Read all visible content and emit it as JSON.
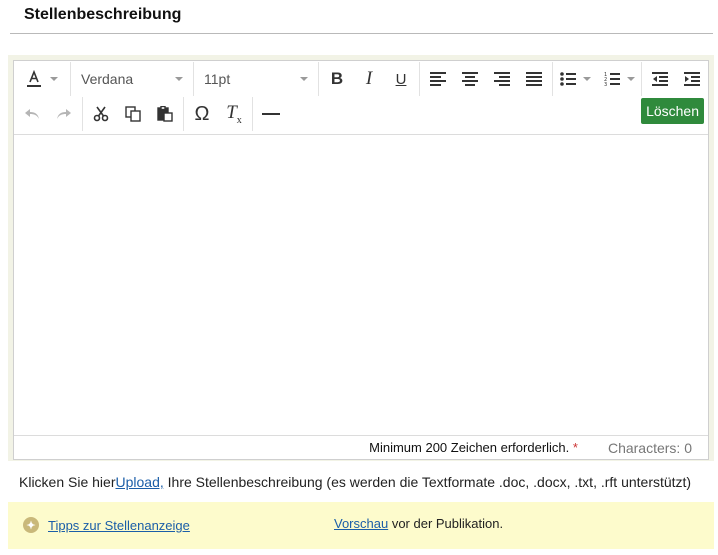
{
  "header": {
    "title": "Stellenbeschreibung"
  },
  "toolbar": {
    "font_family": "Verdana",
    "font_size": "11pt",
    "delete_label": "Löschen"
  },
  "editor": {
    "status_required": "Minimum 200 Zeichen erforderlich.",
    "required_mark": "*",
    "characters": "Characters: 0"
  },
  "upload": {
    "prefix": "Klicken Sie hier",
    "link": "Upload,",
    "suffix": " Ihre Stellenbeschreibung (es werden die Textformate .doc, .docx, .txt, .rft unterstützt)"
  },
  "tips": {
    "link": "Tipps zur Stellenanzeige",
    "preview_link": "Vorschau",
    "preview_suffix": " vor der Publikation."
  },
  "colors": {
    "delete_button": "#2f8a3c",
    "tips_background": "#fdfbcc",
    "link": "#1b5ea8"
  },
  "icons": [
    "text-color-icon",
    "bold-icon",
    "italic-icon",
    "underline-icon",
    "align-left-icon",
    "align-center-icon",
    "align-right-icon",
    "justify-icon",
    "bullet-list-icon",
    "numbered-list-icon",
    "outdent-icon",
    "indent-icon",
    "undo-icon",
    "redo-icon",
    "cut-icon",
    "copy-icon",
    "paste-icon",
    "omega-icon",
    "clear-format-icon",
    "horizontal-rule-icon"
  ]
}
